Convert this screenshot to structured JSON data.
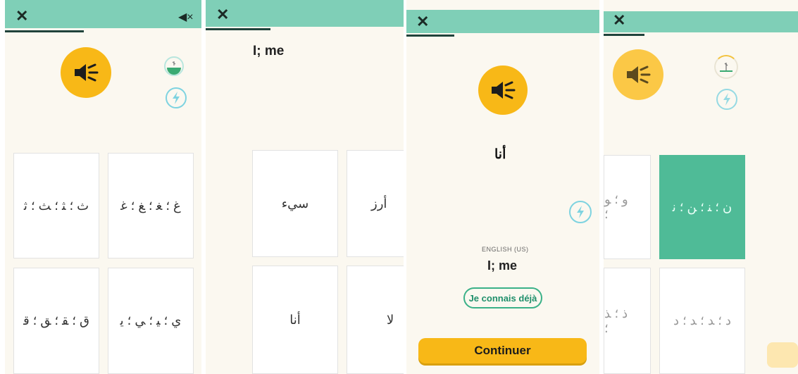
{
  "colors": {
    "accent": "#7fcfb7",
    "brand_yellow": "#f8b817",
    "selected_tile": "#4fbb97",
    "background": "#fbf8f0"
  },
  "icons": {
    "close": "close-icon",
    "mute": "mute-icon",
    "speaker": "speaker-icon",
    "bolt": "lightning-bolt-icon",
    "timer": "timer-icon"
  },
  "panel1": {
    "close": "✕",
    "mute": "◀×",
    "progress": 0.4,
    "tiles": [
      "ث ؛ ﺜ ؛ ﺚ ؛ ﺛ",
      "غ ؛ ﻐ ؛ ﻎ ؛ ﻏ",
      "ق ؛ ﻘ ؛ ﻖ ؛ ﻗ",
      "ي ؛ ﻴ ؛ ﻲ ؛ ﻳ"
    ]
  },
  "panel2": {
    "close": "✕",
    "progress": 0.3,
    "title": "I; me",
    "tiles": [
      "سيء",
      "أرز",
      "أنا",
      "لا"
    ]
  },
  "panel3": {
    "close": "✕",
    "progress": 0.25,
    "word": "أنا",
    "language": "ENGLISH (US)",
    "translation": "I; me",
    "know_button": "Je connais déjà",
    "continue_button": "Continuer"
  },
  "panel4": {
    "close": "✕",
    "progress": 0.3,
    "tiles": [
      "و ؛ ﻮ ؛",
      "ن ؛ ﻨ ؛ ﻦ ؛ ﻧ",
      "ذ ؛ ﺬ ؛",
      "د ؛ ﺪ ؛ ﺪ ؛ د"
    ],
    "selected_tile": 1
  }
}
